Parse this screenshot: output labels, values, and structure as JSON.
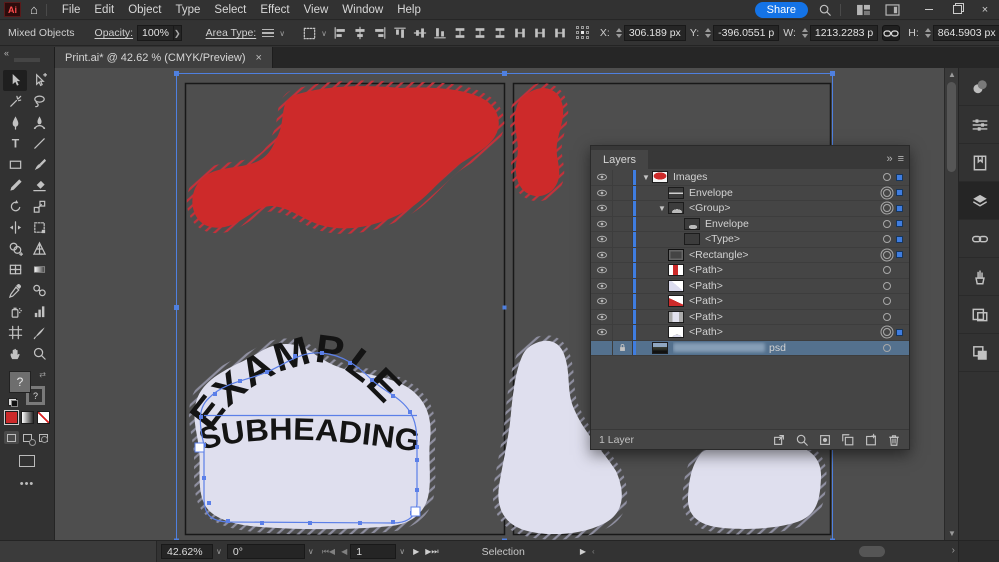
{
  "menubar": {
    "logo": "Ai",
    "items": [
      "File",
      "Edit",
      "Object",
      "Type",
      "Select",
      "Effect",
      "View",
      "Window",
      "Help"
    ],
    "share_label": "Share"
  },
  "controlbar": {
    "selection_label": "Mixed Objects",
    "opacity_label": "Opacity:",
    "opacity_value": "100%",
    "area_type_label": "Area Type:",
    "x_label": "X:",
    "x_value": "306.189 px",
    "y_label": "Y:",
    "y_value": "-396.0551 p",
    "w_label": "W:",
    "w_value": "1213.2283 p",
    "h_label": "H:",
    "h_value": "864.5903 px",
    "align_icons": [
      {
        "name": "align-left",
        "sym": "al",
        "cls": ""
      },
      {
        "name": "align-horizontal-center",
        "sym": "ac",
        "cls": ""
      },
      {
        "name": "align-right",
        "sym": "al",
        "cls": "flipx"
      },
      {
        "name": "align-top",
        "sym": "al",
        "cls": "rot90"
      },
      {
        "name": "align-vertical-center",
        "sym": "ac",
        "cls": "rot90"
      },
      {
        "name": "align-bottom",
        "sym": "al",
        "cls": "rot270"
      },
      {
        "name": "distribute-top",
        "sym": "dv",
        "cls": ""
      },
      {
        "name": "distribute-vertical-center",
        "sym": "dv",
        "cls": ""
      },
      {
        "name": "distribute-bottom",
        "sym": "dv",
        "cls": ""
      },
      {
        "name": "distribute-left",
        "sym": "dv",
        "cls": "rot90"
      },
      {
        "name": "distribute-horizontal-center",
        "sym": "dv",
        "cls": "rot90"
      },
      {
        "name": "distribute-right",
        "sym": "dv",
        "cls": "rot90"
      }
    ]
  },
  "tab": {
    "title": "Print.ai* @ 42.62 % (CMYK/Preview)",
    "close": "×"
  },
  "toolbar": {
    "fill_unknown": "?",
    "stroke_unknown": "?",
    "tools": [
      {
        "name": "selection-tool",
        "sym": "t-sel",
        "active": true
      },
      {
        "name": "direct-selection-tool",
        "sym": "t-dsel"
      },
      {
        "name": "magic-wand-tool",
        "sym": "t-wand"
      },
      {
        "name": "lasso-tool",
        "sym": "t-lasso"
      },
      {
        "name": "pen-tool",
        "sym": "t-pen"
      },
      {
        "name": "curvature-tool",
        "sym": "t-curv"
      },
      {
        "name": "type-tool",
        "sym": "t-type"
      },
      {
        "name": "line-segment-tool",
        "sym": "t-line"
      },
      {
        "name": "rectangle-tool",
        "sym": "t-rect"
      },
      {
        "name": "paintbrush-tool",
        "sym": "t-brush"
      },
      {
        "name": "pencil-tool",
        "sym": "t-pencil"
      },
      {
        "name": "eraser-tool",
        "sym": "t-eraser"
      },
      {
        "name": "rotate-tool",
        "sym": "t-rotate"
      },
      {
        "name": "scale-tool",
        "sym": "t-scale"
      },
      {
        "name": "width-tool",
        "sym": "t-width"
      },
      {
        "name": "free-transform-tool",
        "sym": "t-ftrans"
      },
      {
        "name": "shape-builder-tool",
        "sym": "t-shapebuilder"
      },
      {
        "name": "perspective-grid-tool",
        "sym": "t-persp"
      },
      {
        "name": "mesh-tool",
        "sym": "t-mesh"
      },
      {
        "name": "gradient-tool",
        "sym": "t-grad"
      },
      {
        "name": "eyedropper-tool",
        "sym": "t-eyed"
      },
      {
        "name": "blend-tool",
        "sym": "t-blend"
      },
      {
        "name": "symbol-sprayer-tool",
        "sym": "t-spray"
      },
      {
        "name": "column-graph-tool",
        "sym": "t-graph"
      },
      {
        "name": "artboard-tool",
        "sym": "t-art"
      },
      {
        "name": "slice-tool",
        "sym": "t-slice"
      },
      {
        "name": "hand-tool",
        "sym": "t-hand"
      },
      {
        "name": "zoom-tool",
        "sym": "t-zoom"
      }
    ]
  },
  "canvas": {
    "heading_text": "EXAMPLE",
    "subheading_text": "SUBHEADING"
  },
  "layers_panel": {
    "title": "Layers",
    "footer_count": "1 Layer",
    "rows": [
      {
        "label": "Images",
        "indent": 0,
        "chevron": true,
        "thumb": "th-imgred",
        "target": "ring",
        "chip": true
      },
      {
        "label": "Envelope",
        "indent": 1,
        "chevron": false,
        "thumb": "th-env",
        "target": "double",
        "chip": true
      },
      {
        "label": "<Group>",
        "indent": 1,
        "chevron": true,
        "thumb": "th-group",
        "target": "double",
        "chip": true
      },
      {
        "label": "Envelope",
        "indent": 2,
        "chevron": false,
        "thumb": "th-env2",
        "target": "ring",
        "chip": true
      },
      {
        "label": "<Type>",
        "indent": 2,
        "chevron": false,
        "thumb": "th-type",
        "target": "ring",
        "chip": true
      },
      {
        "label": "<Rectangle>",
        "indent": 1,
        "chevron": false,
        "thumb": "th-rect",
        "target": "double",
        "chip": true
      },
      {
        "label": "<Path>",
        "indent": 1,
        "chevron": false,
        "thumb": "th-redvert",
        "target": "ring",
        "chip": false
      },
      {
        "label": "<Path>",
        "indent": 1,
        "chevron": false,
        "thumb": "th-lavwedge",
        "target": "ring",
        "chip": false
      },
      {
        "label": "<Path>",
        "indent": 1,
        "chevron": false,
        "thumb": "th-reddiag",
        "target": "ring",
        "chip": false
      },
      {
        "label": "<Path>",
        "indent": 1,
        "chevron": false,
        "thumb": "th-whitetall",
        "target": "ring",
        "chip": false
      },
      {
        "label": "<Path>",
        "indent": 1,
        "chevron": false,
        "thumb": "th-whitedome",
        "target": "double",
        "chip": true
      },
      {
        "label": "psd",
        "indent": 0,
        "chevron": false,
        "thumb": "th-psd",
        "target": "ring",
        "chip": false,
        "locked": true,
        "selected": true,
        "blurred_name": true
      }
    ],
    "footer_icons": [
      "collect-for-export-icon",
      "locate-object-icon",
      "make-clip-mask-icon",
      "new-sublayer-icon",
      "new-layer-icon",
      "delete-layer-icon"
    ]
  },
  "right_dock": {
    "icons": [
      {
        "name": "color-panel-icon",
        "sym": "d-color",
        "active": false
      },
      {
        "name": "properties-panel-icon",
        "sym": "d-props",
        "active": false
      },
      {
        "name": "libraries-panel-icon",
        "sym": "d-lib",
        "active": false
      },
      {
        "name": "layers-panel-icon",
        "sym": "d-layers",
        "active": true
      },
      {
        "name": "links-panel-icon",
        "sym": "d-links",
        "active": false
      },
      {
        "name": "brushes-panel-icon",
        "sym": "d-brush",
        "active": false
      },
      {
        "name": "artboards-panel-icon",
        "sym": "d-artb",
        "active": false
      },
      {
        "name": "pathfinder-panel-icon",
        "sym": "d-pathf",
        "active": false
      }
    ]
  },
  "statusbar": {
    "zoom_value": "42.62%",
    "rotation_value": "0°",
    "artboard_value": "1",
    "status_label": "Selection"
  },
  "colors": {
    "accent_blue": "#3f7de0",
    "artwork_red": "#cd2a2a",
    "artwork_lavender": "#dfdfee",
    "share_blue": "#1473e6",
    "selected_row": "#54718e"
  }
}
